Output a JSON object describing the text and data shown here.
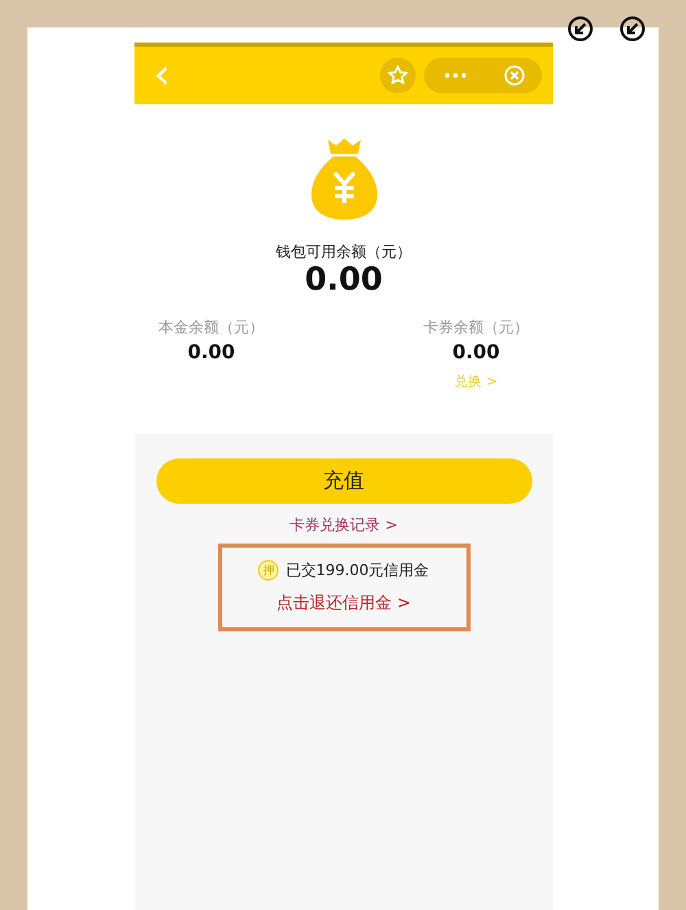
{
  "nav_bar": {
    "back": "‹"
  },
  "wallet": {
    "label": "钱包可用余额（元）",
    "amount": "0.00"
  },
  "balances": [
    {
      "label": "本金余额（元）",
      "amount": "0.00"
    },
    {
      "label": "卡券余额（元）",
      "amount": "0.00",
      "link": "兑换 >"
    }
  ],
  "recharge_button": "充值",
  "record_link": "卡券兑换记录 >",
  "deposit": {
    "badge": "押",
    "text": "已交199.00元信用金",
    "link": "点击退还信用金 >",
    "highlighted": true
  }
}
